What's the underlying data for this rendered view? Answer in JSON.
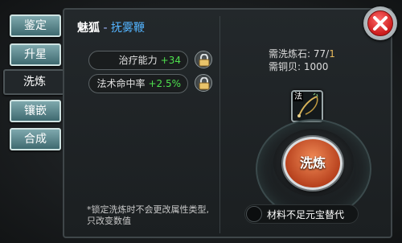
{
  "tabs": [
    {
      "label": "鉴定"
    },
    {
      "label": "升星"
    },
    {
      "label": "洗炼"
    },
    {
      "label": "镶嵌"
    },
    {
      "label": "合成"
    }
  ],
  "header": {
    "name": "魅狐",
    "separator": " - ",
    "item_name": "抚雾鞭"
  },
  "attributes": [
    {
      "name": "治疗能力",
      "value": "+34"
    },
    {
      "name": "法术命中率",
      "value": "+2.5%"
    }
  ],
  "note": "*锁定洗炼时不会更改属性类型, 只改变数值",
  "cost": {
    "stone_label": "需洗炼石: ",
    "stone_have": "77",
    "stone_slash": "/",
    "stone_need": "1",
    "copper_label": "需铜贝: ",
    "copper_value": "1000"
  },
  "item_slot": {
    "tag": "法",
    "icon": "whip-icon"
  },
  "wash_button": {
    "label": "洗炼"
  },
  "substitute": {
    "label": "材料不足元宝替代"
  },
  "icons": {
    "lock": "lock-icon",
    "close": "close-icon"
  },
  "colors": {
    "attr_value": "#4ee04e",
    "item_name": "#53b4ff",
    "wash_button": "#c8532a",
    "close": "#cc1c1c"
  }
}
